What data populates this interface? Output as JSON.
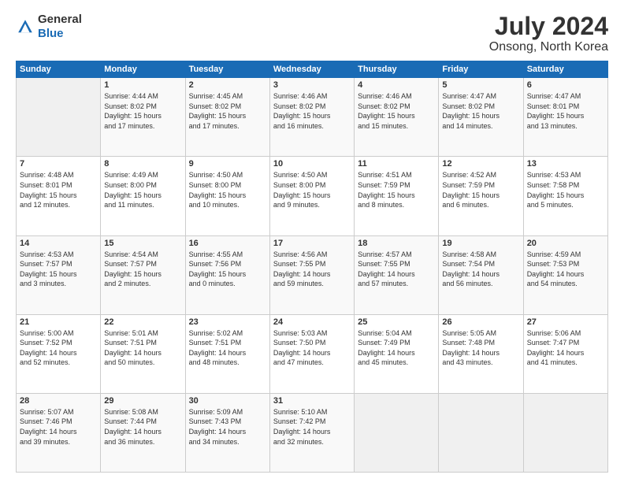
{
  "header": {
    "logo": {
      "general": "General",
      "blue": "Blue"
    },
    "title": "July 2024",
    "location": "Onsong, North Korea"
  },
  "weekdays": [
    "Sunday",
    "Monday",
    "Tuesday",
    "Wednesday",
    "Thursday",
    "Friday",
    "Saturday"
  ],
  "weeks": [
    [
      {
        "day": "",
        "content": ""
      },
      {
        "day": "1",
        "content": "Sunrise: 4:44 AM\nSunset: 8:02 PM\nDaylight: 15 hours\nand 17 minutes."
      },
      {
        "day": "2",
        "content": "Sunrise: 4:45 AM\nSunset: 8:02 PM\nDaylight: 15 hours\nand 17 minutes."
      },
      {
        "day": "3",
        "content": "Sunrise: 4:46 AM\nSunset: 8:02 PM\nDaylight: 15 hours\nand 16 minutes."
      },
      {
        "day": "4",
        "content": "Sunrise: 4:46 AM\nSunset: 8:02 PM\nDaylight: 15 hours\nand 15 minutes."
      },
      {
        "day": "5",
        "content": "Sunrise: 4:47 AM\nSunset: 8:02 PM\nDaylight: 15 hours\nand 14 minutes."
      },
      {
        "day": "6",
        "content": "Sunrise: 4:47 AM\nSunset: 8:01 PM\nDaylight: 15 hours\nand 13 minutes."
      }
    ],
    [
      {
        "day": "7",
        "content": "Sunrise: 4:48 AM\nSunset: 8:01 PM\nDaylight: 15 hours\nand 12 minutes."
      },
      {
        "day": "8",
        "content": "Sunrise: 4:49 AM\nSunset: 8:00 PM\nDaylight: 15 hours\nand 11 minutes."
      },
      {
        "day": "9",
        "content": "Sunrise: 4:50 AM\nSunset: 8:00 PM\nDaylight: 15 hours\nand 10 minutes."
      },
      {
        "day": "10",
        "content": "Sunrise: 4:50 AM\nSunset: 8:00 PM\nDaylight: 15 hours\nand 9 minutes."
      },
      {
        "day": "11",
        "content": "Sunrise: 4:51 AM\nSunset: 7:59 PM\nDaylight: 15 hours\nand 8 minutes."
      },
      {
        "day": "12",
        "content": "Sunrise: 4:52 AM\nSunset: 7:59 PM\nDaylight: 15 hours\nand 6 minutes."
      },
      {
        "day": "13",
        "content": "Sunrise: 4:53 AM\nSunset: 7:58 PM\nDaylight: 15 hours\nand 5 minutes."
      }
    ],
    [
      {
        "day": "14",
        "content": "Sunrise: 4:53 AM\nSunset: 7:57 PM\nDaylight: 15 hours\nand 3 minutes."
      },
      {
        "day": "15",
        "content": "Sunrise: 4:54 AM\nSunset: 7:57 PM\nDaylight: 15 hours\nand 2 minutes."
      },
      {
        "day": "16",
        "content": "Sunrise: 4:55 AM\nSunset: 7:56 PM\nDaylight: 15 hours\nand 0 minutes."
      },
      {
        "day": "17",
        "content": "Sunrise: 4:56 AM\nSunset: 7:55 PM\nDaylight: 14 hours\nand 59 minutes."
      },
      {
        "day": "18",
        "content": "Sunrise: 4:57 AM\nSunset: 7:55 PM\nDaylight: 14 hours\nand 57 minutes."
      },
      {
        "day": "19",
        "content": "Sunrise: 4:58 AM\nSunset: 7:54 PM\nDaylight: 14 hours\nand 56 minutes."
      },
      {
        "day": "20",
        "content": "Sunrise: 4:59 AM\nSunset: 7:53 PM\nDaylight: 14 hours\nand 54 minutes."
      }
    ],
    [
      {
        "day": "21",
        "content": "Sunrise: 5:00 AM\nSunset: 7:52 PM\nDaylight: 14 hours\nand 52 minutes."
      },
      {
        "day": "22",
        "content": "Sunrise: 5:01 AM\nSunset: 7:51 PM\nDaylight: 14 hours\nand 50 minutes."
      },
      {
        "day": "23",
        "content": "Sunrise: 5:02 AM\nSunset: 7:51 PM\nDaylight: 14 hours\nand 48 minutes."
      },
      {
        "day": "24",
        "content": "Sunrise: 5:03 AM\nSunset: 7:50 PM\nDaylight: 14 hours\nand 47 minutes."
      },
      {
        "day": "25",
        "content": "Sunrise: 5:04 AM\nSunset: 7:49 PM\nDaylight: 14 hours\nand 45 minutes."
      },
      {
        "day": "26",
        "content": "Sunrise: 5:05 AM\nSunset: 7:48 PM\nDaylight: 14 hours\nand 43 minutes."
      },
      {
        "day": "27",
        "content": "Sunrise: 5:06 AM\nSunset: 7:47 PM\nDaylight: 14 hours\nand 41 minutes."
      }
    ],
    [
      {
        "day": "28",
        "content": "Sunrise: 5:07 AM\nSunset: 7:46 PM\nDaylight: 14 hours\nand 39 minutes."
      },
      {
        "day": "29",
        "content": "Sunrise: 5:08 AM\nSunset: 7:44 PM\nDaylight: 14 hours\nand 36 minutes."
      },
      {
        "day": "30",
        "content": "Sunrise: 5:09 AM\nSunset: 7:43 PM\nDaylight: 14 hours\nand 34 minutes."
      },
      {
        "day": "31",
        "content": "Sunrise: 5:10 AM\nSunset: 7:42 PM\nDaylight: 14 hours\nand 32 minutes."
      },
      {
        "day": "",
        "content": ""
      },
      {
        "day": "",
        "content": ""
      },
      {
        "day": "",
        "content": ""
      }
    ]
  ]
}
